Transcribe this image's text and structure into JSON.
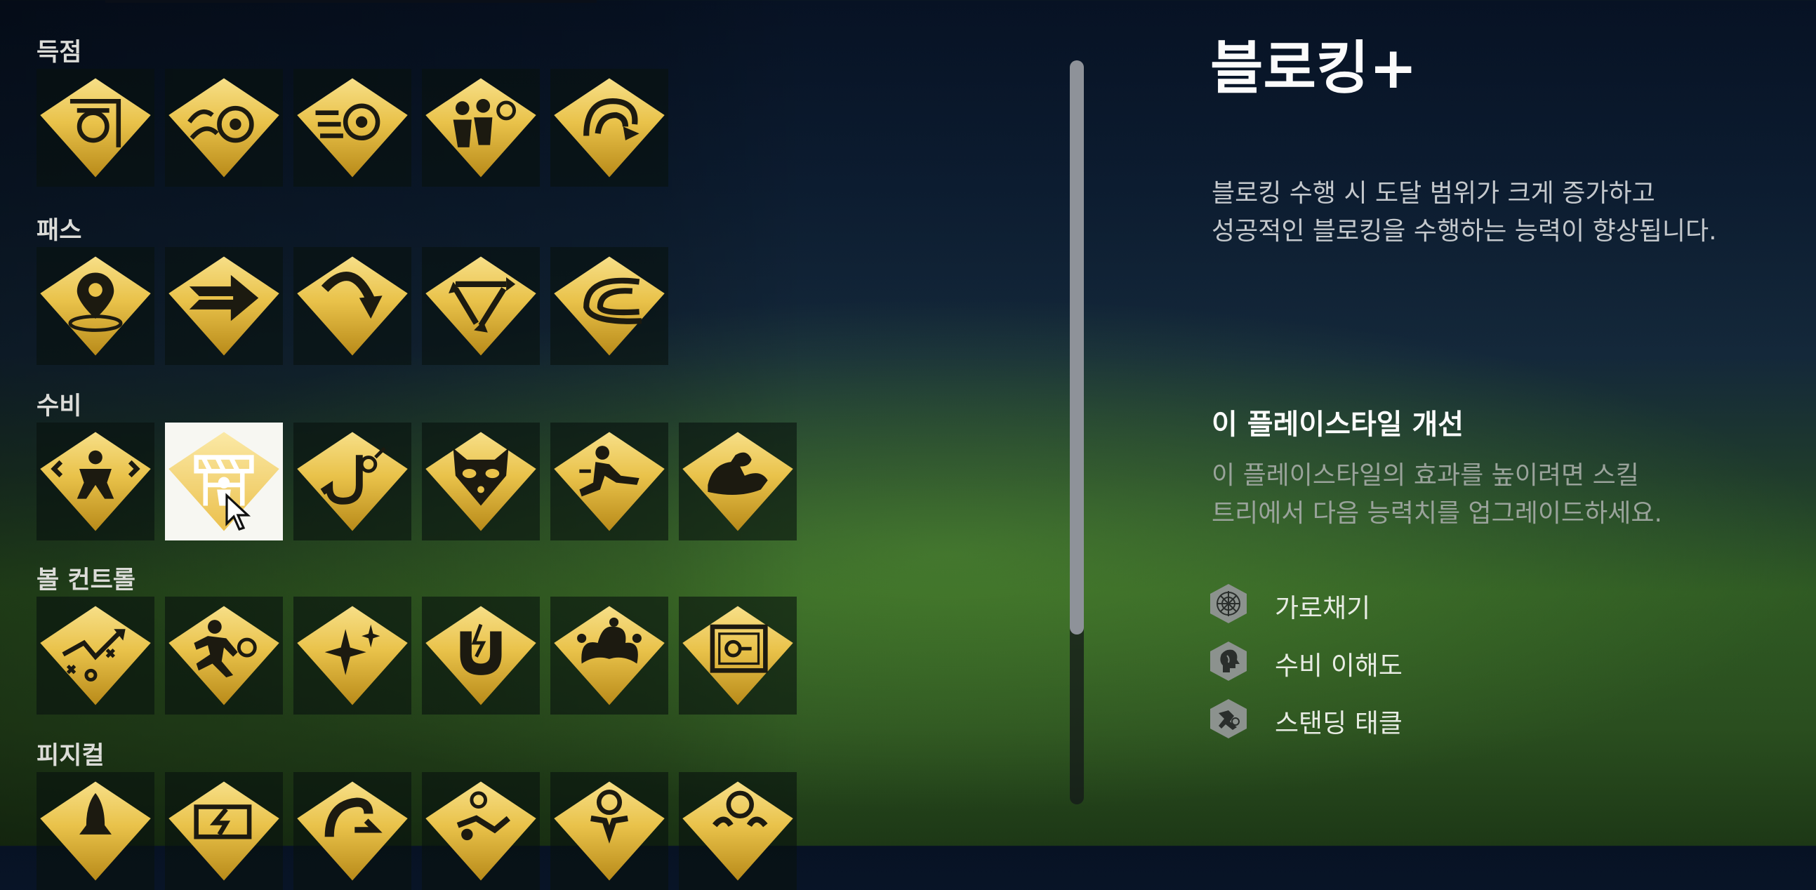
{
  "categories": [
    {
      "label": "득점",
      "icons": [
        "finesse-shot-icon",
        "power-header-icon",
        "power-shot-icon",
        "team-player-icon",
        "chip-shot-icon"
      ]
    },
    {
      "label": "패스",
      "icons": [
        "location-pass-icon",
        "whipped-pass-icon",
        "curve-pass-icon",
        "tiki-taka-icon",
        "long-ball-icon"
      ]
    },
    {
      "label": "수비",
      "icons": [
        "jockey-icon",
        "block-icon",
        "intercept-hook-icon",
        "anticipate-raccoon-icon",
        "slide-tackle-icon",
        "bruiser-icon"
      ]
    },
    {
      "label": "볼 컨트롤",
      "icons": [
        "tactical-dribble-icon",
        "first-touch-icon",
        "trickster-icon",
        "press-proven-magnet-icon",
        "flair-jester-icon",
        "technical-safe-icon"
      ]
    },
    {
      "label": "피지컬",
      "icons": [
        "rocket-icon",
        "relentless-battery-icon",
        "long-throw-icon",
        "acrobatic-icon",
        "aerial-icon",
        "footwork-icon"
      ]
    }
  ],
  "selected": {
    "category": 2,
    "index": 1
  },
  "detail": {
    "title": "블로킹+",
    "description": [
      "블로킹 수행 시 도달 범위가 크게 증가하고",
      "성공적인 블로킹을 수행하는 능력이 향상됩니다."
    ],
    "improve_title": "이 플레이스타일 개선",
    "improve_description": [
      "이 플레이스타일의 효과를 높이려면 스킬",
      "트리에서 다음 능력치를 업그레이드하세요."
    ],
    "stats": [
      {
        "label": "가로채기",
        "icon": "web-icon"
      },
      {
        "label": "수비 이해도",
        "icon": "head-awareness-icon"
      },
      {
        "label": "스탠딩 태클",
        "icon": "tackle-icon"
      }
    ]
  },
  "colors": {
    "gold": "#e9c24a",
    "gold_dark": "#b88a19",
    "glyph": "#1c1a10"
  }
}
